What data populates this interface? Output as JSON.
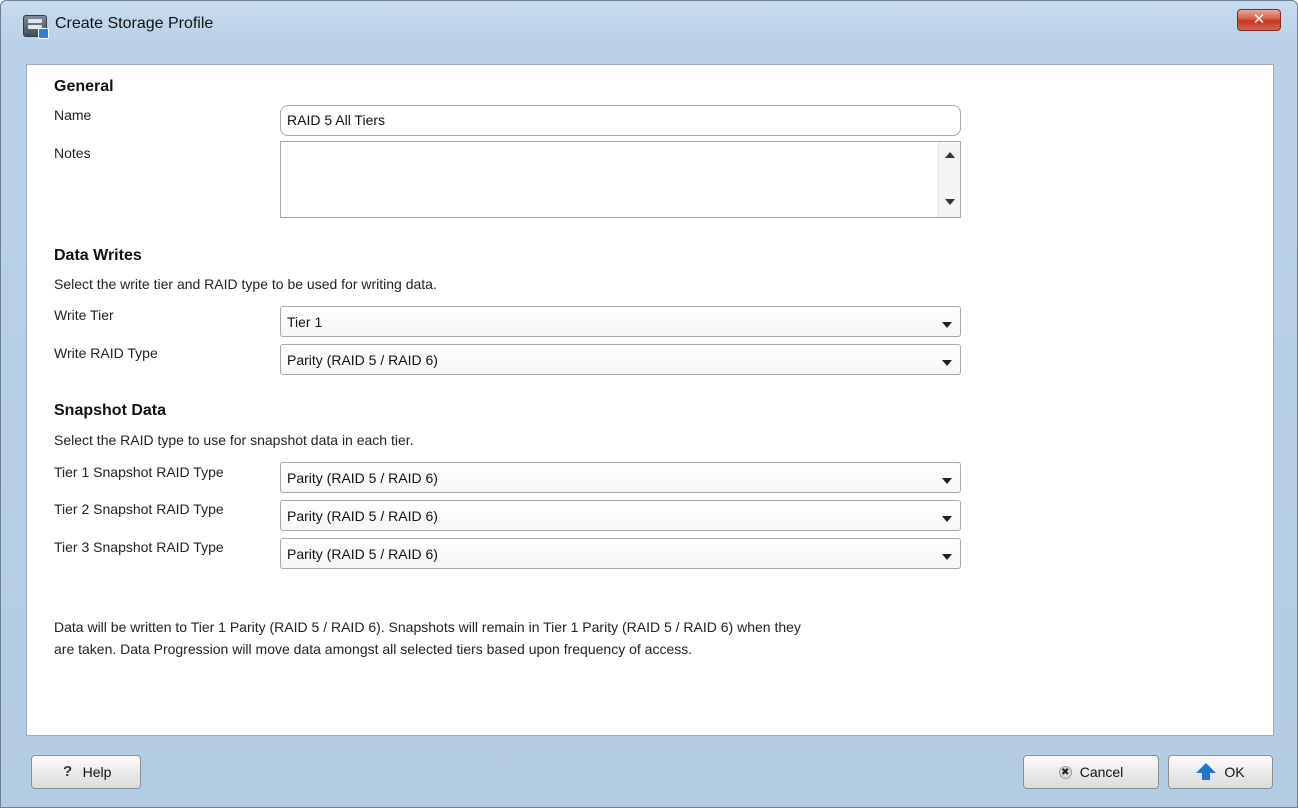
{
  "window": {
    "title": "Create Storage Profile",
    "close_glyph": "✕"
  },
  "general": {
    "title": "General",
    "name_label": "Name",
    "name_value": "RAID 5 All Tiers",
    "notes_label": "Notes",
    "notes_value": ""
  },
  "data_writes": {
    "title": "Data Writes",
    "description": "Select the write tier and RAID type to be used for writing data.",
    "write_tier_label": "Write Tier",
    "write_tier_value": "Tier 1",
    "write_raid_label": "Write RAID Type",
    "write_raid_value": "Parity (RAID 5 / RAID 6)"
  },
  "snapshot": {
    "title": "Snapshot Data",
    "description": "Select the RAID type to use for snapshot data in each tier.",
    "rows": [
      {
        "label": "Tier 1 Snapshot RAID Type",
        "value": "Parity (RAID 5 / RAID 6)"
      },
      {
        "label": "Tier 2 Snapshot RAID Type",
        "value": "Parity (RAID 5 / RAID 6)"
      },
      {
        "label": "Tier 3 Snapshot RAID Type",
        "value": "Parity (RAID 5 / RAID 6)"
      }
    ]
  },
  "summary": {
    "line1": "Data will be written to Tier 1 Parity (RAID 5 / RAID 6). Snapshots will remain in Tier 1 Parity (RAID 5 / RAID 6) when they",
    "line2": "are taken. Data Progression will move data amongst all selected tiers based upon frequency of access."
  },
  "footer": {
    "help_label": "Help",
    "help_glyph": "?",
    "cancel_label": "Cancel",
    "cancel_glyph": "✖",
    "ok_label": "OK"
  },
  "icons": {
    "app": "storage-profile-icon",
    "help": "question-icon",
    "cancel": "cancel-x-icon",
    "ok": "up-arrow-icon",
    "dropdown": "chevron-down-icon"
  },
  "colors": {
    "frame": "#b9d1ea",
    "close": "#c0391f",
    "ok_arrow": "#1f74cf"
  }
}
